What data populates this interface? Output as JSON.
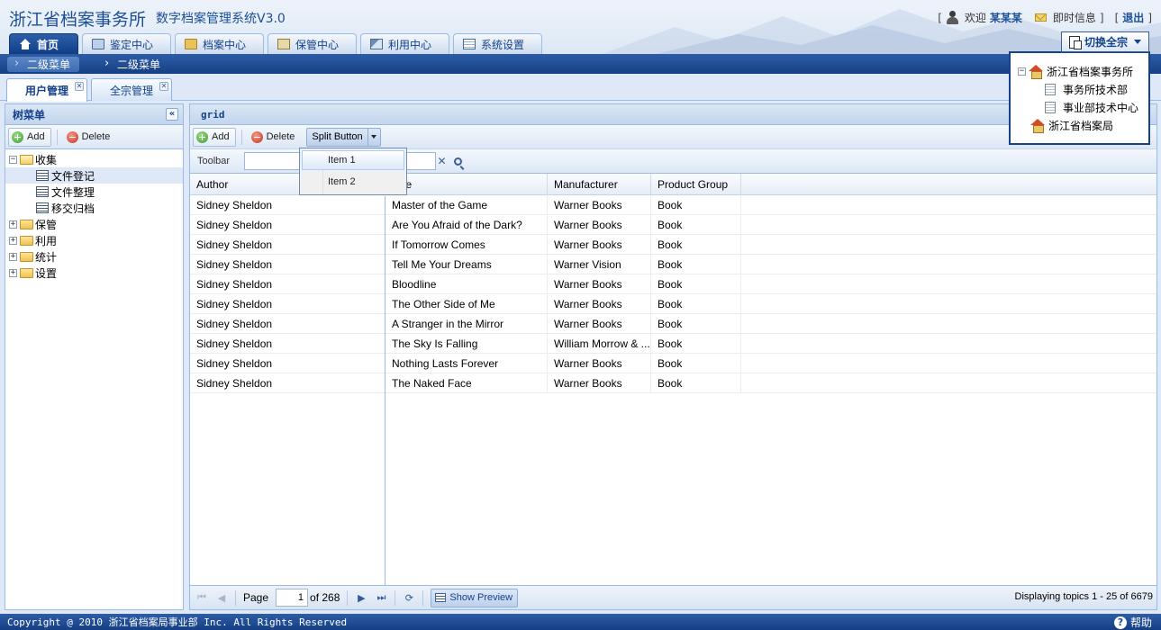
{
  "header": {
    "title": "浙江省档案事务所",
    "subtitle": "数字档案管理系统V3.0",
    "welcome": "欢迎",
    "username": "某某某",
    "messages": "即时信息",
    "logout": "退出",
    "bracket_open": "[",
    "bracket_close": "]"
  },
  "main_tabs": [
    {
      "label": "首页",
      "icon": "home-icon",
      "active": true
    },
    {
      "label": "鉴定中心",
      "icon": "monitor-icon"
    },
    {
      "label": "档案中心",
      "icon": "folder-icon"
    },
    {
      "label": "保管中心",
      "icon": "printer-icon"
    },
    {
      "label": "利用中心",
      "icon": "tool-icon"
    },
    {
      "label": "系统设置",
      "icon": "settings-icon"
    }
  ],
  "switch": {
    "label": "切换全宗",
    "tree": [
      {
        "label": "浙江省档案事务所"
      },
      {
        "label": "事务所技术部"
      },
      {
        "label": "事业部技术中心"
      },
      {
        "label": "浙江省档案局"
      }
    ]
  },
  "subnav": [
    {
      "label": "二级菜单",
      "active": true
    },
    {
      "label": "二级菜单"
    }
  ],
  "content_tabs": [
    {
      "label": "用户管理",
      "active": true
    },
    {
      "label": "全宗管理"
    }
  ],
  "left_panel": {
    "title": "树菜单",
    "add": "Add",
    "delete": "Delete",
    "tree": [
      {
        "label": "收集",
        "toggle": "⊟"
      },
      {
        "label": "文件登记"
      },
      {
        "label": "文件整理"
      },
      {
        "label": "移交归档"
      },
      {
        "label": "保管",
        "toggle": "⊞"
      },
      {
        "label": "利用",
        "toggle": "⊞"
      },
      {
        "label": "统计",
        "toggle": "⊞"
      },
      {
        "label": "设置",
        "toggle": "⊞"
      }
    ]
  },
  "grid_panel": {
    "title": "grid",
    "add": "Add",
    "delete": "Delete",
    "split_button": "Split Button",
    "toolbar_label": "Toolbar",
    "menu_items": [
      "Item 1",
      "Item 2"
    ],
    "columns": [
      "Author",
      "Title",
      "Manufacturer",
      "Product Group"
    ],
    "rows": [
      [
        "Sidney Sheldon",
        "Master of the Game",
        "Warner Books",
        "Book"
      ],
      [
        "Sidney Sheldon",
        "Are You Afraid of the Dark?",
        "Warner Books",
        "Book"
      ],
      [
        "Sidney Sheldon",
        "If Tomorrow Comes",
        "Warner Books",
        "Book"
      ],
      [
        "Sidney Sheldon",
        "Tell Me Your Dreams",
        "Warner Vision",
        "Book"
      ],
      [
        "Sidney Sheldon",
        "Bloodline",
        "Warner Books",
        "Book"
      ],
      [
        "Sidney Sheldon",
        "The Other Side of Me",
        "Warner Books",
        "Book"
      ],
      [
        "Sidney Sheldon",
        "A Stranger in the Mirror",
        "Warner Books",
        "Book"
      ],
      [
        "Sidney Sheldon",
        "The Sky Is Falling",
        "William Morrow & ...",
        "Book"
      ],
      [
        "Sidney Sheldon",
        "Nothing Lasts Forever",
        "Warner Books",
        "Book"
      ],
      [
        "Sidney Sheldon",
        "The Naked Face",
        "Warner Books",
        "Book"
      ]
    ],
    "pager": {
      "page_label": "Page",
      "page_value": "1",
      "of_label": "of 268",
      "show_preview": "Show Preview",
      "display_info": "Displaying topics 1 - 25 of 6679"
    }
  },
  "footer": {
    "copyright": "Copyright @ 2010 浙江省档案局事业部 Inc. All Rights Reserved",
    "help": "帮助"
  }
}
